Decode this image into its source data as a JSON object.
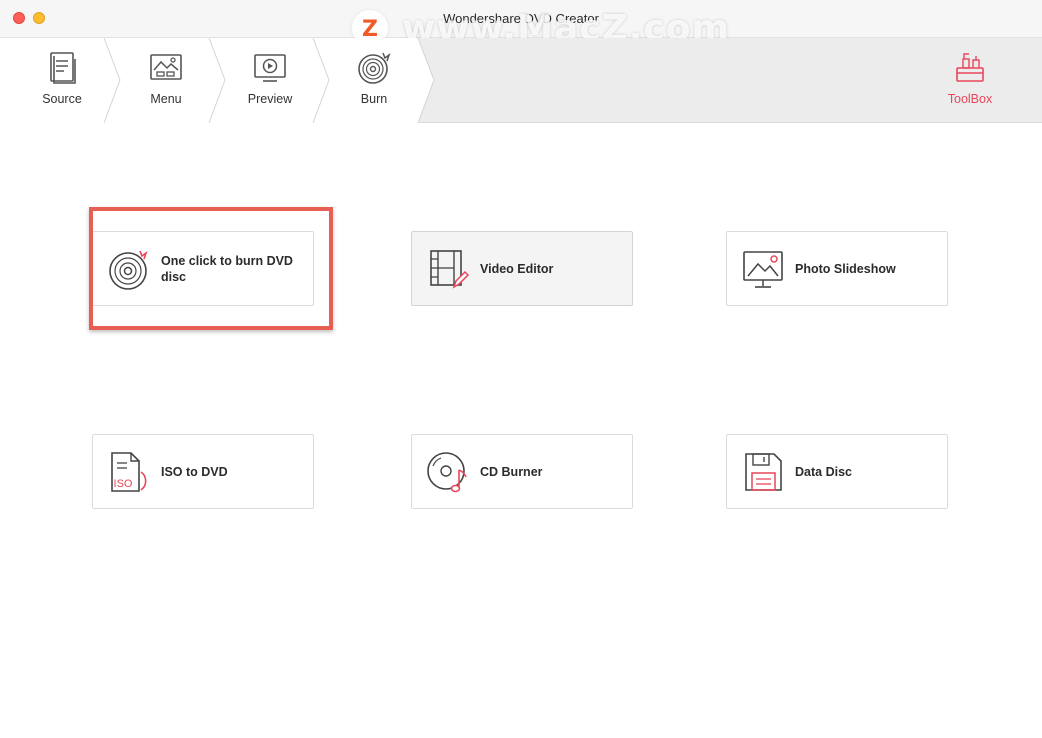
{
  "window": {
    "title": "Wondershare DVD Creator",
    "watermark": "www.MacZ.com",
    "watermark_logo": "Z"
  },
  "steps": [
    {
      "label": "Source",
      "icon": "source-icon"
    },
    {
      "label": "Menu",
      "icon": "menu-icon"
    },
    {
      "label": "Preview",
      "icon": "preview-icon"
    },
    {
      "label": "Burn",
      "icon": "burn-icon"
    }
  ],
  "toolbox": {
    "label": "ToolBox",
    "icon": "toolbox-icon",
    "active": true
  },
  "tools": [
    {
      "label": "One click to burn DVD disc",
      "icon": "disc-burn-icon",
      "highlighted": true
    },
    {
      "label": "Video Editor",
      "icon": "video-editor-icon",
      "hovered": true
    },
    {
      "label": "Photo Slideshow",
      "icon": "photo-slideshow-icon"
    },
    {
      "label": "ISO to DVD",
      "icon": "iso-file-icon",
      "icon_text": "ISO"
    },
    {
      "label": "CD Burner",
      "icon": "cd-music-icon"
    },
    {
      "label": "Data Disc",
      "icon": "floppy-disk-icon"
    }
  ],
  "colors": {
    "accent": "#e8475b",
    "highlight_frame": "#e65f52",
    "watermark_logo": "#f05a28"
  }
}
